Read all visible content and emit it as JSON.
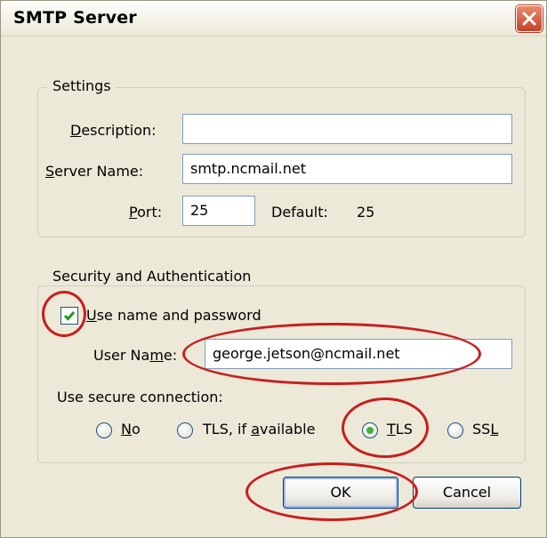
{
  "dialog": {
    "title": "SMTP Server",
    "close_icon": "close-icon"
  },
  "settings": {
    "legend": "Settings",
    "description": {
      "label": "Description:",
      "mnemonic": "D",
      "rest": "escription:",
      "value": ""
    },
    "server_name": {
      "label": "Server Name:",
      "mnemonic": "S",
      "rest": "erver Name:",
      "value": "smtp.ncmail.net"
    },
    "port": {
      "label": "Port:",
      "mnemonic": "P",
      "rest": "ort:",
      "value": "25"
    },
    "default_label": "Default:",
    "default_value": "25"
  },
  "security": {
    "legend": "Security and Authentication",
    "use_name_password": {
      "label": "Use name and password",
      "mnemonic": "U",
      "rest": "se name and password",
      "checked": true
    },
    "user_name": {
      "label": "User Name:",
      "prefix": "User Na",
      "mnemonic": "m",
      "suffix": "e:",
      "value": "george.jetson@ncmail.net"
    },
    "secure_connection_label": "Use secure connection:",
    "options": [
      {
        "label": "No",
        "selected": false
      },
      {
        "label": "TLS, if available",
        "selected": false
      },
      {
        "label": "TLS",
        "selected": true
      },
      {
        "label": "SSL",
        "selected": false
      }
    ]
  },
  "buttons": {
    "ok": "OK",
    "cancel": "Cancel"
  },
  "colors": {
    "dialog_bg": "#ece9d8",
    "annotation": "#c81e1e",
    "close_button": "#c4412a",
    "radio_selected": "#3fae3a",
    "checkbox_check": "#1d9b1d"
  }
}
